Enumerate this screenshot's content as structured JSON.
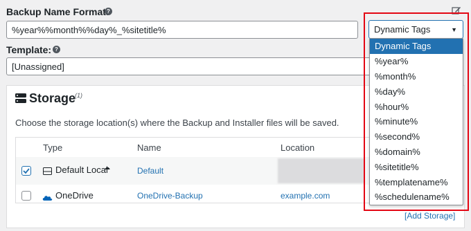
{
  "backup_name": {
    "label": "Backup Name Format:",
    "value": "%year%%month%%day%_%sitetitle%",
    "select_value": "Dynamic Tags"
  },
  "template": {
    "label": "Template:",
    "value": "[Unassigned]"
  },
  "storage": {
    "title": "Storage",
    "superscript": "(1)",
    "description": "Choose the storage location(s) where the Backup and Installer files will be saved.",
    "columns": [
      "Type",
      "Name",
      "Location"
    ],
    "rows": [
      {
        "type": "Default Local",
        "name": "Default",
        "location": "",
        "checked": true
      },
      {
        "type": "OneDrive",
        "name": "OneDrive-Backup",
        "location": "example.com",
        "checked": false
      }
    ],
    "add_link": "[Add Storage]"
  },
  "dropdown": {
    "options": [
      "Dynamic Tags",
      "%year%",
      "%month%",
      "%day%",
      "%hour%",
      "%minute%",
      "%second%",
      "%domain%",
      "%sitetitle%",
      "%templatename%",
      "%schedulename%"
    ],
    "selected_index": 0
  },
  "colors": {
    "accent": "#2271b1",
    "highlight": "#e30613",
    "onedrive": "#0364b8"
  }
}
